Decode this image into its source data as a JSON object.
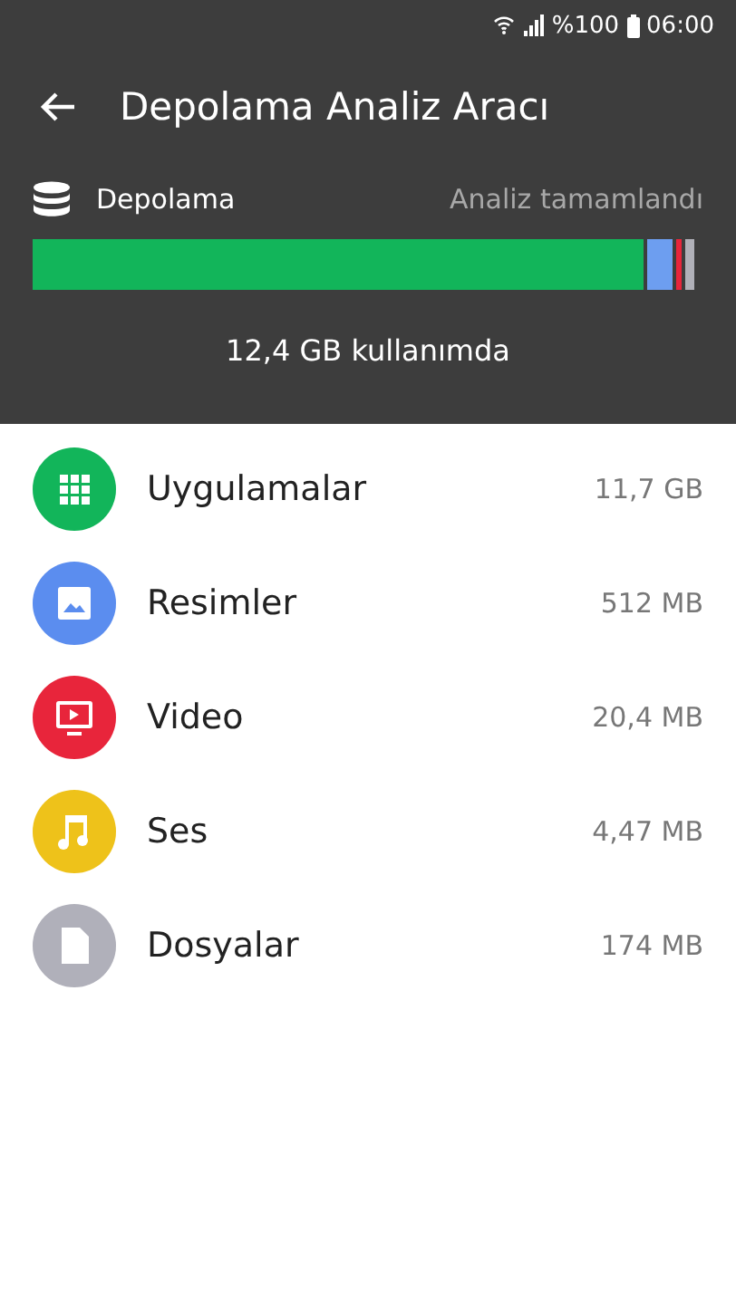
{
  "status_bar": {
    "battery_text": "%100",
    "time": "06:00"
  },
  "app_bar": {
    "title": "Depolama Analiz Aracı"
  },
  "storage": {
    "label": "Depolama",
    "status": "Analiz tamamlandı",
    "summary": "12,4 GB kullanımda",
    "segments": [
      {
        "color": "#12b55a"
      },
      {
        "color": "#6d9ef0"
      },
      {
        "color": "#e8253b"
      },
      {
        "color": "#b0b0b8"
      }
    ]
  },
  "categories": [
    {
      "kind": "apps",
      "label": "Uygulamalar",
      "size": "11,7 GB",
      "color": "#12b55a"
    },
    {
      "kind": "images",
      "label": "Resimler",
      "size": "512 MB",
      "color": "#5b8def"
    },
    {
      "kind": "video",
      "label": "Video",
      "size": "20,4 MB",
      "color": "#e8253b"
    },
    {
      "kind": "audio",
      "label": "Ses",
      "size": "4,47 MB",
      "color": "#eec21a"
    },
    {
      "kind": "files",
      "label": "Dosyalar",
      "size": "174 MB",
      "color": "#b0b0ba"
    }
  ]
}
